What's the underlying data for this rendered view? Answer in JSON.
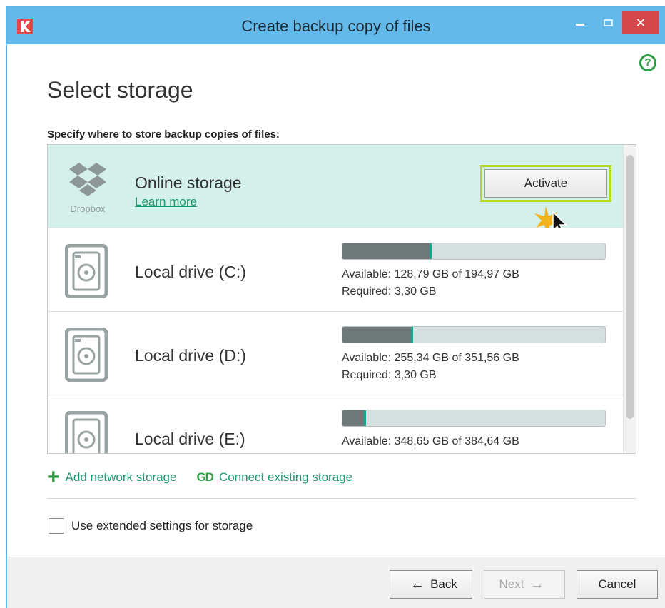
{
  "window": {
    "title": "Create backup copy of files",
    "close_glyph": "✕",
    "help_glyph": "?"
  },
  "page": {
    "heading": "Select storage",
    "subtitle": "Specify where to store backup copies of files:"
  },
  "online": {
    "name": "Online storage",
    "provider": "Dropbox",
    "learn_more": "Learn more",
    "activate_label": "Activate"
  },
  "drives": [
    {
      "name": "Local drive (C:)",
      "available": "Available: 128,79 GB of 194,97 GB",
      "required": "Required: 3,30 GB",
      "used_fraction": 0.34
    },
    {
      "name": "Local drive (D:)",
      "available": "Available: 255,34 GB of 351,56 GB",
      "required": "Required: 3,30 GB",
      "used_fraction": 0.27
    },
    {
      "name": "Local drive (E:)",
      "available": "Available: 348,65 GB of 384,64 GB",
      "required": "",
      "used_fraction": 0.09
    }
  ],
  "actions": {
    "add_network": "Add network storage",
    "connect_existing": "Connect existing storage",
    "connect_glyph": "GD"
  },
  "options": {
    "extended_settings_label": "Use extended settings for storage",
    "extended_settings_checked": false
  },
  "footer": {
    "back_label": "Back",
    "next_label": "Next",
    "cancel_label": "Cancel",
    "back_arrow": "←",
    "next_arrow": "→"
  },
  "colors": {
    "titlebar": "#63b9ea",
    "selected_row": "#d4f0ea",
    "link": "#1f9a6c",
    "accent_green": "#2ea043",
    "activate_highlight": "#b7d62a",
    "close_button": "#d6474a"
  },
  "icons": {
    "app": "kaspersky-logo-icon",
    "online": "dropbox-icon",
    "drive": "hard-drive-icon",
    "add": "plus-icon",
    "connect": "link-icon",
    "help": "help-icon",
    "cursor": "mouse-cursor-icon"
  }
}
